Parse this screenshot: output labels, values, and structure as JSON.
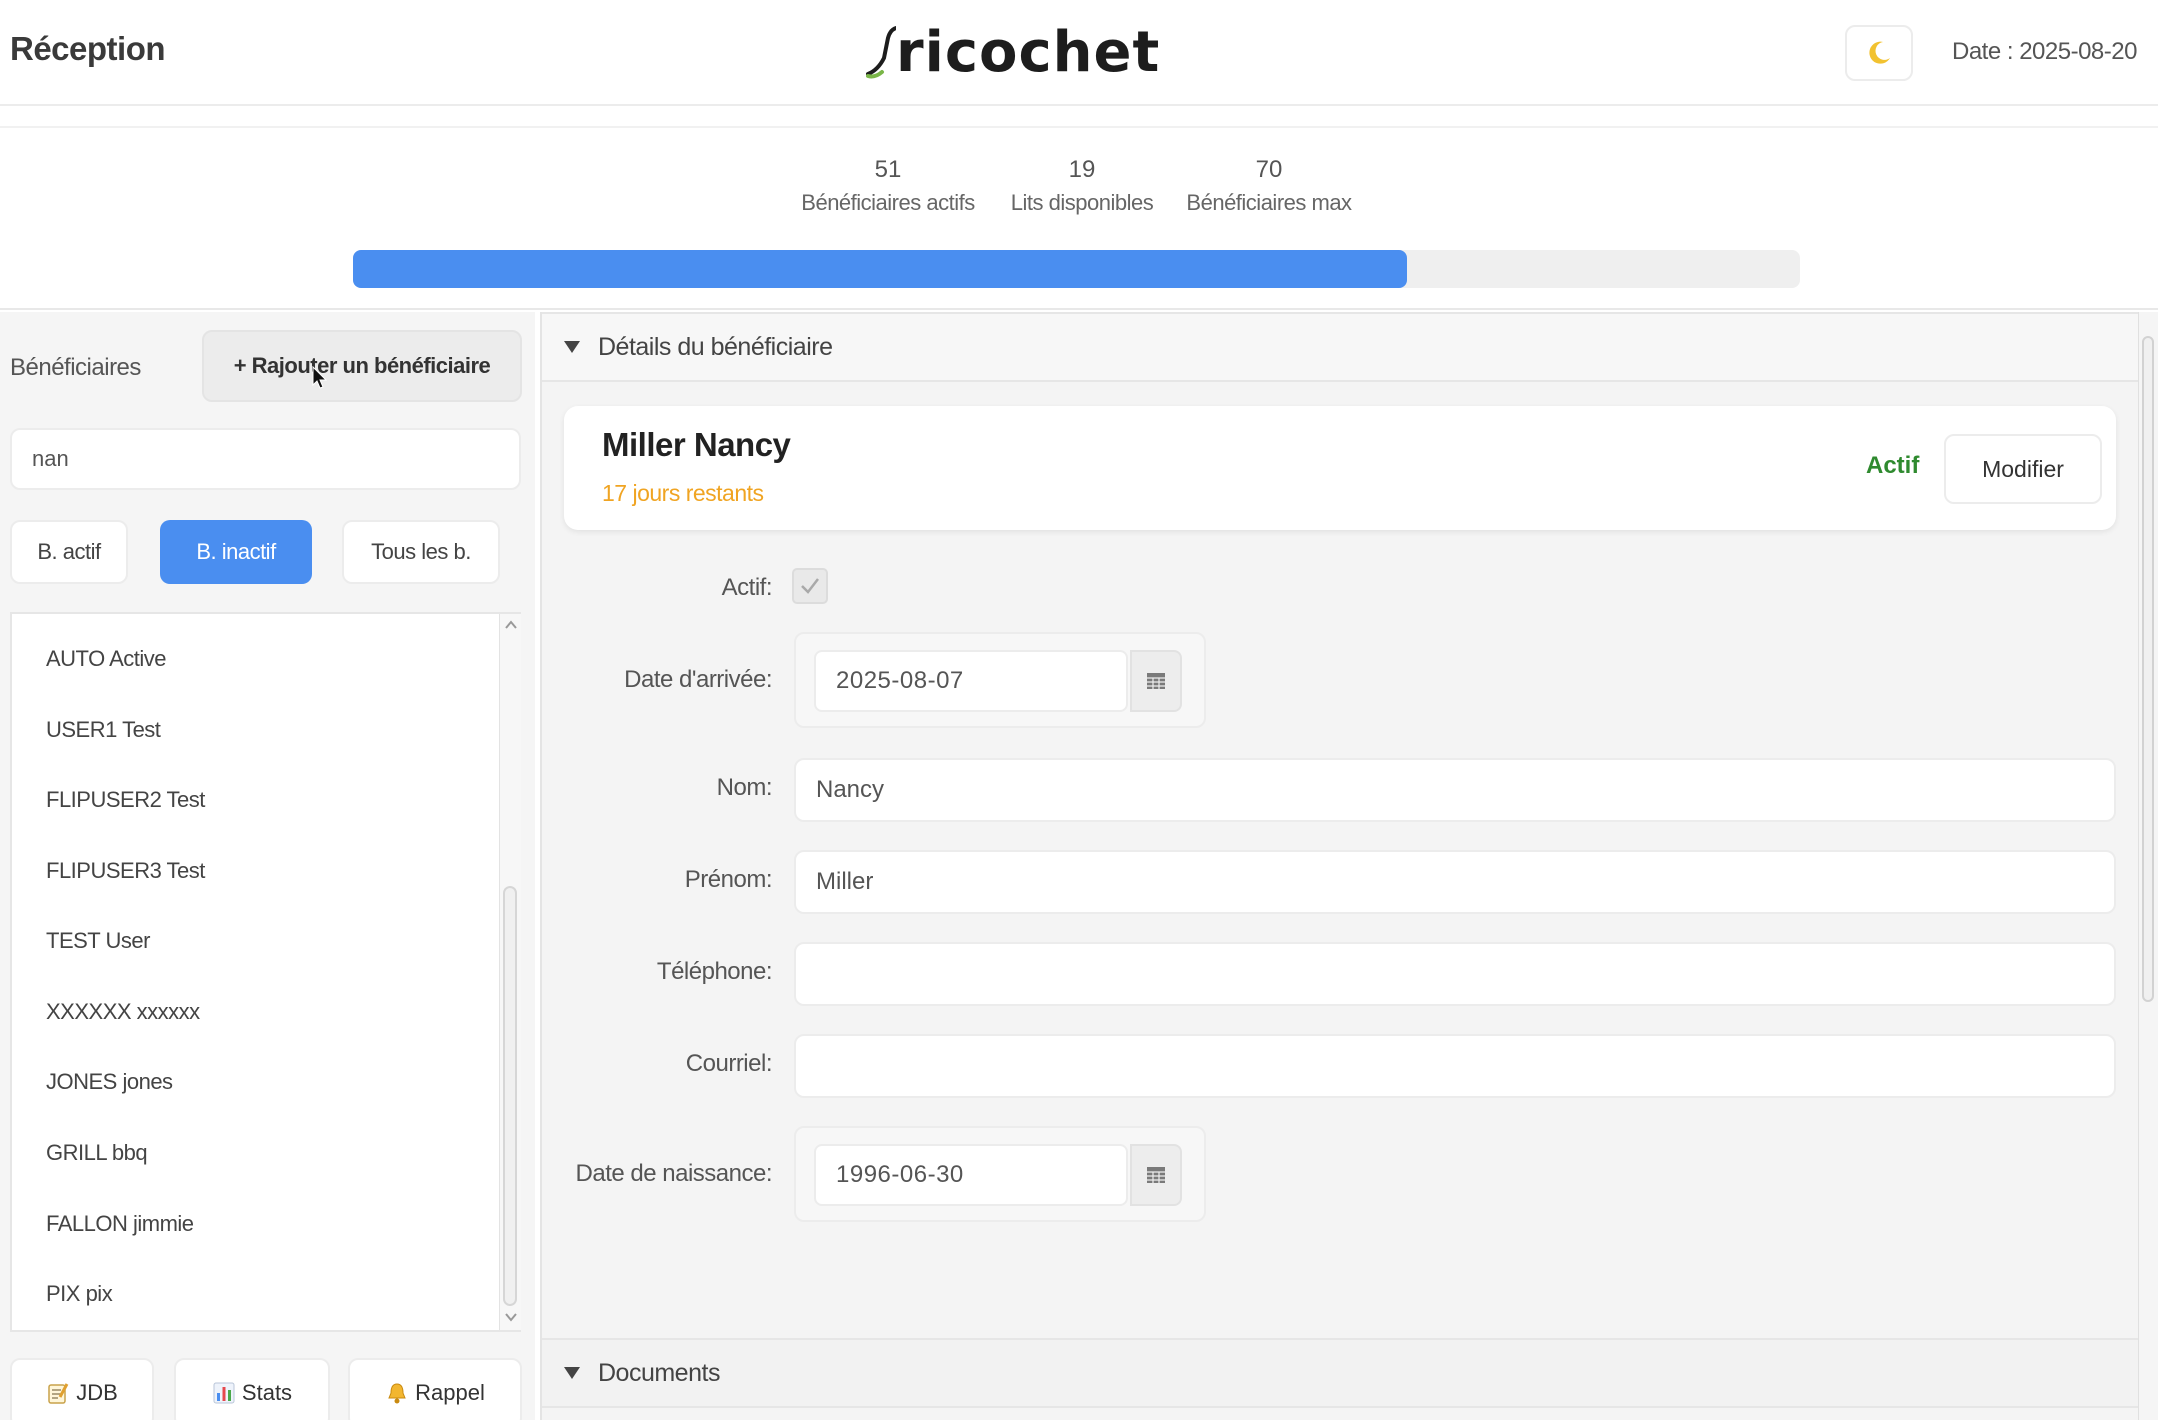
{
  "header": {
    "page_title": "Réception",
    "logo_text": "ricochet",
    "date_label": "Date : 2025-08-20",
    "theme_icon": "moon-icon"
  },
  "stats": {
    "active": {
      "value": "51",
      "label": "Bénéficiaires actifs"
    },
    "available": {
      "value": "19",
      "label": "Lits disponibles"
    },
    "max": {
      "value": "70",
      "label": "Bénéficiaires max"
    },
    "occupancy_fraction": 0.7286,
    "accent_color": "#4a8ef0"
  },
  "sidebar": {
    "title": "Bénéficiaires",
    "add_button": "+ Rajouter un bénéficiaire",
    "search_value": "nan",
    "filters": [
      {
        "label": "B. actif",
        "active": false
      },
      {
        "label": "B. inactif",
        "active": true
      },
      {
        "label": "Tous les b.",
        "active": false
      }
    ],
    "items": [
      "AUTO Active",
      "USER1 Test",
      "FLIPUSER2 Test",
      "FLIPUSER3 Test",
      "TEST User",
      "XXXXXX xxxxxx",
      "JONES jones",
      "GRILL bbq",
      "FALLON jimmie",
      "PIX pix"
    ],
    "bottom_buttons": [
      {
        "label": "JDB",
        "icon": "memo-icon"
      },
      {
        "label": "Stats",
        "icon": "bar-chart-icon"
      },
      {
        "label": "Rappel",
        "icon": "bell-icon"
      }
    ]
  },
  "details": {
    "section_title": "Détails du bénéficiaire",
    "name": "Miller Nancy",
    "days_remaining": "17 jours restants",
    "status": "Actif",
    "modify_button": "Modifier",
    "fields": {
      "active_label": "Actif:",
      "active_checked": true,
      "arrival_label": "Date d'arrivée:",
      "arrival_value": "2025-08-07",
      "last_name_label": "Nom:",
      "last_name_value": "Nancy",
      "first_name_label": "Prénom:",
      "first_name_value": "Miller",
      "phone_label": "Téléphone:",
      "phone_value": "",
      "email_label": "Courriel:",
      "email_value": "",
      "birth_label": "Date de naissance:",
      "birth_value": "1996-06-30"
    },
    "documents_title": "Documents"
  }
}
